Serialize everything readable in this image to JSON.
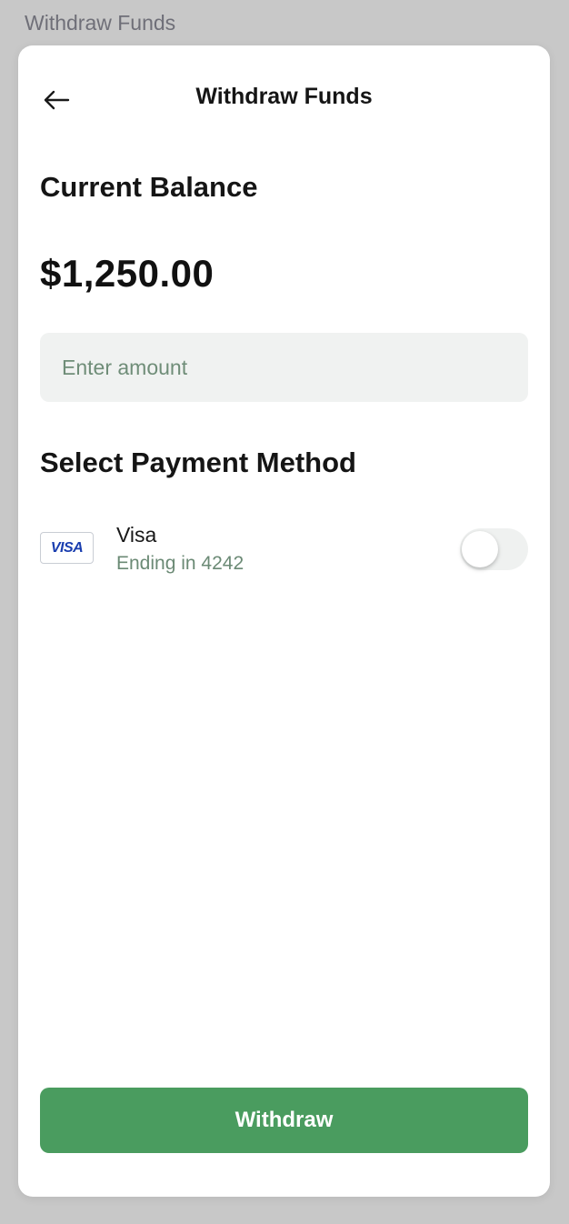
{
  "backdrop": {
    "title": "Withdraw Funds"
  },
  "header": {
    "title": "Withdraw Funds",
    "back_icon": "arrow-left-icon"
  },
  "balance": {
    "label": "Current Balance",
    "value": "$1,250.00"
  },
  "amount_input": {
    "placeholder": "Enter amount",
    "value": ""
  },
  "payment": {
    "label": "Select Payment Method",
    "methods": [
      {
        "logo_text": "VISA",
        "name": "Visa",
        "detail": "Ending in 4242",
        "selected": false
      }
    ]
  },
  "actions": {
    "withdraw_label": "Withdraw"
  },
  "colors": {
    "accent": "#4a9c5f",
    "input_bg": "#f0f2f1",
    "muted_green_text": "#6b8a75",
    "visa_blue": "#1a3eaf",
    "backdrop": "#c8c8c8"
  }
}
